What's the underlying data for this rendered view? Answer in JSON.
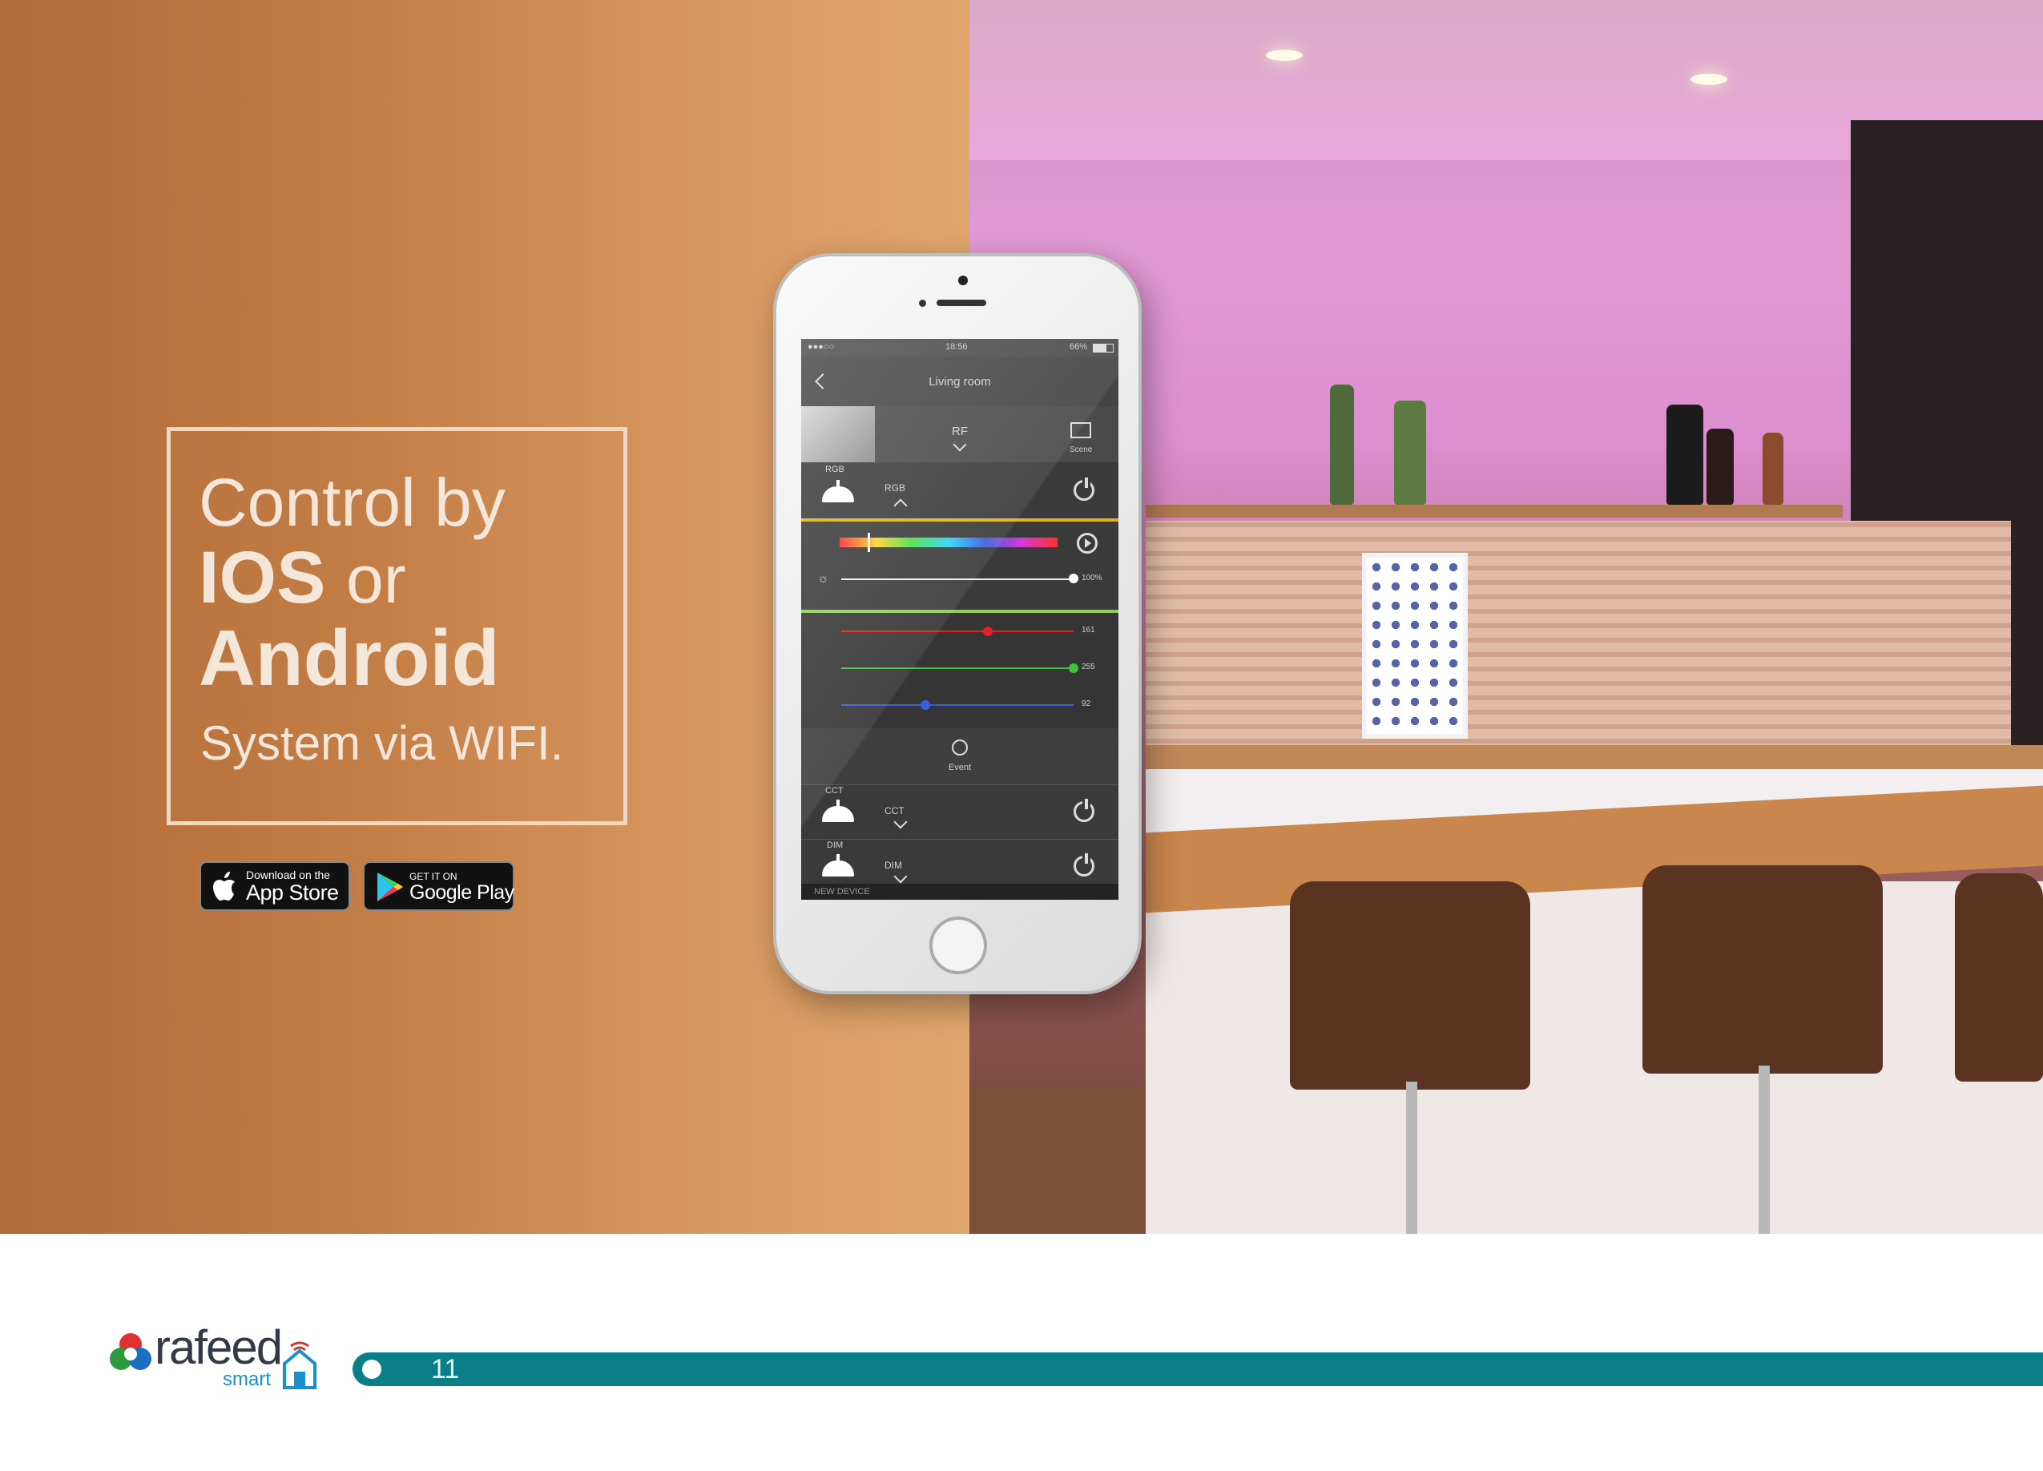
{
  "headline": {
    "line1": "Control by",
    "ios": "IOS",
    "or": "or",
    "android": "Android",
    "line4": "System via WIFI."
  },
  "badges": {
    "appstore_small": "Download on the",
    "appstore_big": "App Store",
    "googleplay_small": "GET IT ON",
    "googleplay_big": "Google Play"
  },
  "phone": {
    "status_time": "18:56",
    "status_battery": "66%",
    "title": "Living room",
    "group_label": "RF",
    "scene_label": "Scene",
    "devices": [
      {
        "tag": "RGB",
        "name": "RGB"
      },
      {
        "tag": "CCT",
        "name": "CCT"
      },
      {
        "tag": "DIM",
        "name": "DIM"
      }
    ],
    "brightness": "100%",
    "brightness_level": 1.0,
    "hue_position": 0.13,
    "rgb": [
      {
        "channel": "red",
        "value": "161",
        "color": "#e02424"
      },
      {
        "channel": "green",
        "value": "255",
        "color": "#3cc43c"
      },
      {
        "channel": "blue",
        "value": "92",
        "color": "#3a5ee0"
      }
    ],
    "event_label": "Event",
    "new_device": "NEW DEVICE"
  },
  "footer": {
    "brand": "rafeed",
    "brand_sub": "smart",
    "page_number": "11"
  },
  "colors": {
    "accent_teal": "#0a7f87",
    "panel_orange": "#c47f47",
    "divider_yellow": "#e3b21d",
    "divider_green": "#8fd14f"
  }
}
